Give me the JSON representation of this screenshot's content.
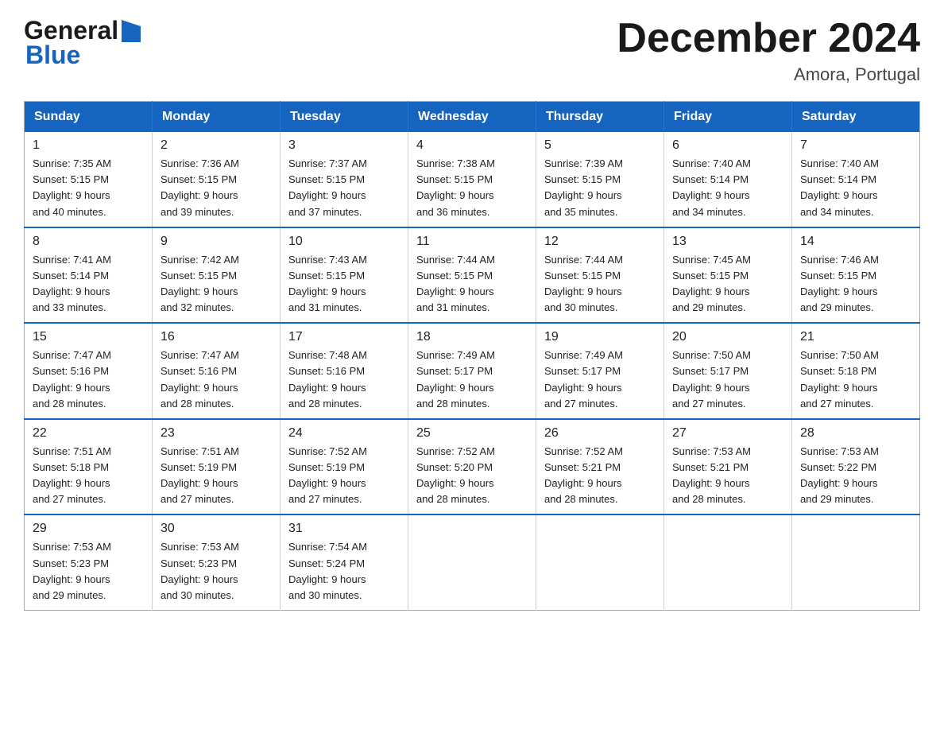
{
  "header": {
    "logo_general": "General",
    "logo_blue": "Blue",
    "month_title": "December 2024",
    "location": "Amora, Portugal"
  },
  "calendar": {
    "days_of_week": [
      "Sunday",
      "Monday",
      "Tuesday",
      "Wednesday",
      "Thursday",
      "Friday",
      "Saturday"
    ],
    "weeks": [
      [
        {
          "day": "1",
          "sunrise": "7:35 AM",
          "sunset": "5:15 PM",
          "daylight": "9 hours and 40 minutes."
        },
        {
          "day": "2",
          "sunrise": "7:36 AM",
          "sunset": "5:15 PM",
          "daylight": "9 hours and 39 minutes."
        },
        {
          "day": "3",
          "sunrise": "7:37 AM",
          "sunset": "5:15 PM",
          "daylight": "9 hours and 37 minutes."
        },
        {
          "day": "4",
          "sunrise": "7:38 AM",
          "sunset": "5:15 PM",
          "daylight": "9 hours and 36 minutes."
        },
        {
          "day": "5",
          "sunrise": "7:39 AM",
          "sunset": "5:15 PM",
          "daylight": "9 hours and 35 minutes."
        },
        {
          "day": "6",
          "sunrise": "7:40 AM",
          "sunset": "5:14 PM",
          "daylight": "9 hours and 34 minutes."
        },
        {
          "day": "7",
          "sunrise": "7:40 AM",
          "sunset": "5:14 PM",
          "daylight": "9 hours and 34 minutes."
        }
      ],
      [
        {
          "day": "8",
          "sunrise": "7:41 AM",
          "sunset": "5:14 PM",
          "daylight": "9 hours and 33 minutes."
        },
        {
          "day": "9",
          "sunrise": "7:42 AM",
          "sunset": "5:15 PM",
          "daylight": "9 hours and 32 minutes."
        },
        {
          "day": "10",
          "sunrise": "7:43 AM",
          "sunset": "5:15 PM",
          "daylight": "9 hours and 31 minutes."
        },
        {
          "day": "11",
          "sunrise": "7:44 AM",
          "sunset": "5:15 PM",
          "daylight": "9 hours and 31 minutes."
        },
        {
          "day": "12",
          "sunrise": "7:44 AM",
          "sunset": "5:15 PM",
          "daylight": "9 hours and 30 minutes."
        },
        {
          "day": "13",
          "sunrise": "7:45 AM",
          "sunset": "5:15 PM",
          "daylight": "9 hours and 29 minutes."
        },
        {
          "day": "14",
          "sunrise": "7:46 AM",
          "sunset": "5:15 PM",
          "daylight": "9 hours and 29 minutes."
        }
      ],
      [
        {
          "day": "15",
          "sunrise": "7:47 AM",
          "sunset": "5:16 PM",
          "daylight": "9 hours and 28 minutes."
        },
        {
          "day": "16",
          "sunrise": "7:47 AM",
          "sunset": "5:16 PM",
          "daylight": "9 hours and 28 minutes."
        },
        {
          "day": "17",
          "sunrise": "7:48 AM",
          "sunset": "5:16 PM",
          "daylight": "9 hours and 28 minutes."
        },
        {
          "day": "18",
          "sunrise": "7:49 AM",
          "sunset": "5:17 PM",
          "daylight": "9 hours and 28 minutes."
        },
        {
          "day": "19",
          "sunrise": "7:49 AM",
          "sunset": "5:17 PM",
          "daylight": "9 hours and 27 minutes."
        },
        {
          "day": "20",
          "sunrise": "7:50 AM",
          "sunset": "5:17 PM",
          "daylight": "9 hours and 27 minutes."
        },
        {
          "day": "21",
          "sunrise": "7:50 AM",
          "sunset": "5:18 PM",
          "daylight": "9 hours and 27 minutes."
        }
      ],
      [
        {
          "day": "22",
          "sunrise": "7:51 AM",
          "sunset": "5:18 PM",
          "daylight": "9 hours and 27 minutes."
        },
        {
          "day": "23",
          "sunrise": "7:51 AM",
          "sunset": "5:19 PM",
          "daylight": "9 hours and 27 minutes."
        },
        {
          "day": "24",
          "sunrise": "7:52 AM",
          "sunset": "5:19 PM",
          "daylight": "9 hours and 27 minutes."
        },
        {
          "day": "25",
          "sunrise": "7:52 AM",
          "sunset": "5:20 PM",
          "daylight": "9 hours and 28 minutes."
        },
        {
          "day": "26",
          "sunrise": "7:52 AM",
          "sunset": "5:21 PM",
          "daylight": "9 hours and 28 minutes."
        },
        {
          "day": "27",
          "sunrise": "7:53 AM",
          "sunset": "5:21 PM",
          "daylight": "9 hours and 28 minutes."
        },
        {
          "day": "28",
          "sunrise": "7:53 AM",
          "sunset": "5:22 PM",
          "daylight": "9 hours and 29 minutes."
        }
      ],
      [
        {
          "day": "29",
          "sunrise": "7:53 AM",
          "sunset": "5:23 PM",
          "daylight": "9 hours and 29 minutes."
        },
        {
          "day": "30",
          "sunrise": "7:53 AM",
          "sunset": "5:23 PM",
          "daylight": "9 hours and 30 minutes."
        },
        {
          "day": "31",
          "sunrise": "7:54 AM",
          "sunset": "5:24 PM",
          "daylight": "9 hours and 30 minutes."
        },
        null,
        null,
        null,
        null
      ]
    ],
    "labels": {
      "sunrise": "Sunrise:",
      "sunset": "Sunset:",
      "daylight": "Daylight:"
    }
  }
}
